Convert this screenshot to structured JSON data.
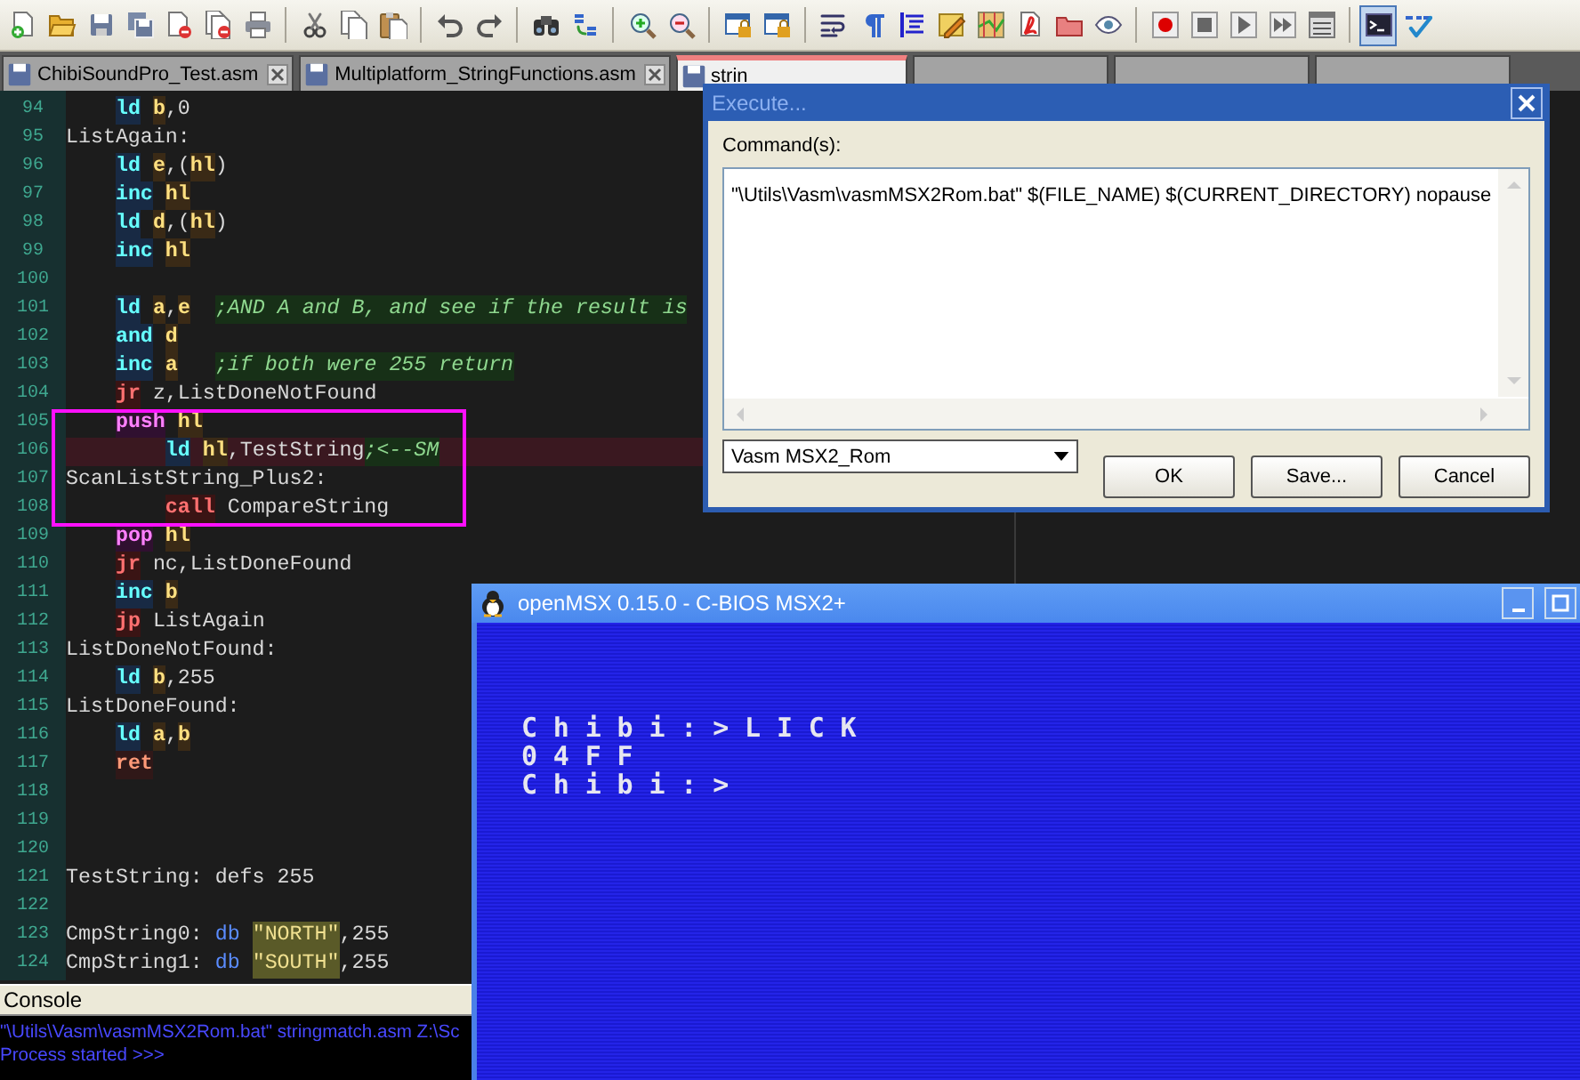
{
  "toolbar": {
    "console_button": {
      "on": true
    }
  },
  "tabs": [
    {
      "label": "ChibiSoundPro_Test.asm",
      "selected": false
    },
    {
      "label": "Multiplatform_StringFunctions.asm",
      "selected": false
    },
    {
      "label": "strin",
      "selected": true
    }
  ],
  "editor": {
    "lines": [
      {
        "number": "94",
        "kind": "instruction",
        "highlighted": false,
        "tokens": [
          {
            "text": "ld",
            "kind": "op"
          },
          {
            "text": "b",
            "kind": "reg"
          },
          {
            "text": ",0",
            "kind": "text"
          }
        ]
      },
      {
        "number": "95",
        "kind": "label",
        "highlighted": false,
        "tokens": [
          {
            "text": "ListAgain:",
            "kind": "text"
          }
        ]
      },
      {
        "number": "96",
        "kind": "instruction",
        "highlighted": false,
        "tokens": [
          {
            "text": "ld",
            "kind": "op"
          },
          {
            "text": "e",
            "kind": "reg"
          },
          {
            "text": ",(",
            "kind": "text"
          },
          {
            "text": "hl",
            "kind": "reg"
          },
          {
            "text": ")",
            "kind": "text"
          }
        ]
      },
      {
        "number": "97",
        "kind": "instruction",
        "highlighted": false,
        "tokens": [
          {
            "text": "inc",
            "kind": "op"
          },
          {
            "text": "hl",
            "kind": "reg"
          }
        ]
      },
      {
        "number": "98",
        "kind": "instruction",
        "highlighted": false,
        "tokens": [
          {
            "text": "ld",
            "kind": "op"
          },
          {
            "text": "d",
            "kind": "reg"
          },
          {
            "text": ",(",
            "kind": "text"
          },
          {
            "text": "hl",
            "kind": "reg"
          },
          {
            "text": ")",
            "kind": "text"
          }
        ]
      },
      {
        "number": "99",
        "kind": "instruction",
        "highlighted": false,
        "tokens": [
          {
            "text": "inc",
            "kind": "op"
          },
          {
            "text": "hl",
            "kind": "reg"
          }
        ]
      },
      {
        "number": "100",
        "kind": "blank",
        "highlighted": false
      },
      {
        "number": "101",
        "kind": "instruction",
        "highlighted": false,
        "tokens": [
          {
            "text": "ld",
            "kind": "op"
          },
          {
            "text": "a",
            "kind": "reg"
          },
          {
            "text": ",",
            "kind": "text"
          },
          {
            "text": "e",
            "kind": "reg"
          },
          {
            "text": ";AND A and B, and see if the result is",
            "kind": "comment"
          }
        ]
      },
      {
        "number": "102",
        "kind": "instruction",
        "highlighted": false,
        "tokens": [
          {
            "text": "and",
            "kind": "op"
          },
          {
            "text": "d",
            "kind": "reg"
          }
        ]
      },
      {
        "number": "103",
        "kind": "instruction",
        "highlighted": false,
        "tokens": [
          {
            "text": "inc",
            "kind": "op"
          },
          {
            "text": "a",
            "kind": "reg"
          },
          {
            "text": ";if both were 255 return",
            "kind": "comment"
          }
        ]
      },
      {
        "number": "104",
        "kind": "instruction",
        "highlighted": false,
        "tokens": [
          {
            "text": "jr",
            "kind": "branch"
          },
          {
            "text": "z,ListDoneNotFound",
            "kind": "text"
          }
        ]
      },
      {
        "number": "105",
        "kind": "instruction",
        "highlighted": false,
        "tokens": [
          {
            "text": "push",
            "kind": "stack"
          },
          {
            "text": "hl",
            "kind": "reg"
          }
        ]
      },
      {
        "number": "106",
        "kind": "nested",
        "highlighted": true,
        "tokens": [
          {
            "text": "ld",
            "kind": "op"
          },
          {
            "text": "hl",
            "kind": "reg"
          },
          {
            "text": ",TestString",
            "kind": "text"
          },
          {
            "text": ";<--SM",
            "kind": "inline_comment"
          }
        ]
      },
      {
        "number": "107",
        "kind": "label",
        "highlighted": false,
        "tokens": [
          {
            "text": "ScanListString_Plus2:",
            "kind": "text"
          }
        ]
      },
      {
        "number": "108",
        "kind": "nested",
        "highlighted": false,
        "tokens": [
          {
            "text": "call",
            "kind": "branch"
          },
          {
            "text": "CompareString",
            "kind": "text"
          }
        ]
      },
      {
        "number": "109",
        "kind": "instruction",
        "highlighted": false,
        "tokens": [
          {
            "text": "pop",
            "kind": "stack"
          },
          {
            "text": "hl",
            "kind": "reg"
          }
        ]
      },
      {
        "number": "110",
        "kind": "instruction",
        "highlighted": false,
        "tokens": [
          {
            "text": "jr",
            "kind": "branch"
          },
          {
            "text": "nc,ListDoneFound",
            "kind": "text"
          }
        ]
      },
      {
        "number": "111",
        "kind": "instruction",
        "highlighted": false,
        "tokens": [
          {
            "text": "inc",
            "kind": "op"
          },
          {
            "text": "b",
            "kind": "reg"
          }
        ]
      },
      {
        "number": "112",
        "kind": "instruction",
        "highlighted": false,
        "tokens": [
          {
            "text": "jp",
            "kind": "branch"
          },
          {
            "text": "ListAgain",
            "kind": "text"
          }
        ]
      },
      {
        "number": "113",
        "kind": "label",
        "highlighted": false,
        "tokens": [
          {
            "text": "ListDoneNotFound:",
            "kind": "text"
          }
        ]
      },
      {
        "number": "114",
        "kind": "instruction",
        "highlighted": false,
        "tokens": [
          {
            "text": "ld",
            "kind": "op"
          },
          {
            "text": "b",
            "kind": "reg"
          },
          {
            "text": ",255",
            "kind": "text"
          }
        ]
      },
      {
        "number": "115",
        "kind": "label",
        "highlighted": false,
        "tokens": [
          {
            "text": "ListDoneFound:",
            "kind": "text"
          }
        ]
      },
      {
        "number": "116",
        "kind": "instruction",
        "highlighted": false,
        "tokens": [
          {
            "text": "ld",
            "kind": "op"
          },
          {
            "text": "a",
            "kind": "reg"
          },
          {
            "text": ",",
            "kind": "text"
          },
          {
            "text": "b",
            "kind": "reg"
          }
        ]
      },
      {
        "number": "117",
        "kind": "instruction",
        "highlighted": false,
        "tokens": [
          {
            "text": "ret",
            "kind": "ret"
          }
        ]
      },
      {
        "number": "118",
        "kind": "blank",
        "highlighted": false
      },
      {
        "number": "119",
        "kind": "blank",
        "highlighted": false
      },
      {
        "number": "120",
        "kind": "blank",
        "highlighted": false
      },
      {
        "number": "121",
        "kind": "label",
        "highlighted": false,
        "tokens": [
          {
            "text": "TestString: defs 255",
            "kind": "text"
          }
        ]
      },
      {
        "number": "122",
        "kind": "blank",
        "highlighted": false
      },
      {
        "number": "123",
        "kind": "label",
        "highlighted": false,
        "tokens": [
          {
            "text": "CmpString0:",
            "kind": "text"
          },
          {
            "text": "db",
            "kind": "directive"
          },
          {
            "text": "\"NORTH\"",
            "kind": "string"
          },
          {
            "text": ",255",
            "kind": "text"
          }
        ]
      },
      {
        "number": "124",
        "kind": "label",
        "highlighted": false,
        "tokens": [
          {
            "text": "CmpString1:",
            "kind": "text"
          },
          {
            "text": "db",
            "kind": "directive"
          },
          {
            "text": "\"SOUTH\"",
            "kind": "string"
          },
          {
            "text": ",255",
            "kind": "text"
          }
        ]
      }
    ]
  },
  "console": {
    "title": "Console",
    "lines": [
      "\"\\Utils\\Vasm\\vasmMSX2Rom.bat\" stringmatch.asm Z:\\Sc",
      "Process started >>>"
    ]
  },
  "execute_dialog": {
    "title": "Execute...",
    "command_label": "Command(s):",
    "command": "\"\\Utils\\Vasm\\vasmMSX2Rom.bat\" $(FILE_NAME) $(CURRENT_DIRECTORY) nopause",
    "preset": "Vasm MSX2_Rom",
    "buttons": [
      "OK",
      "Save...",
      "Cancel"
    ]
  },
  "emulator": {
    "title": "openMSX 0.15.0 - C-BIOS MSX2+",
    "screen_lines": [
      "Chibi:>LICK",
      "04FF",
      "Chibi:>"
    ]
  }
}
